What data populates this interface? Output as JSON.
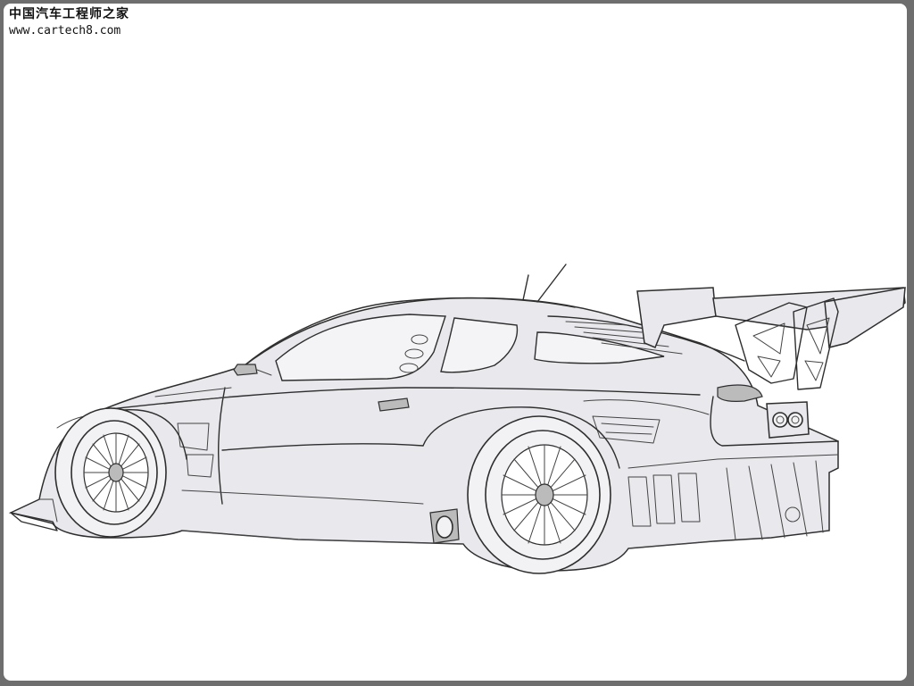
{
  "watermark": {
    "site_name_cn": "中国汽车工程师之家",
    "url": "www.cartech8.com"
  }
}
